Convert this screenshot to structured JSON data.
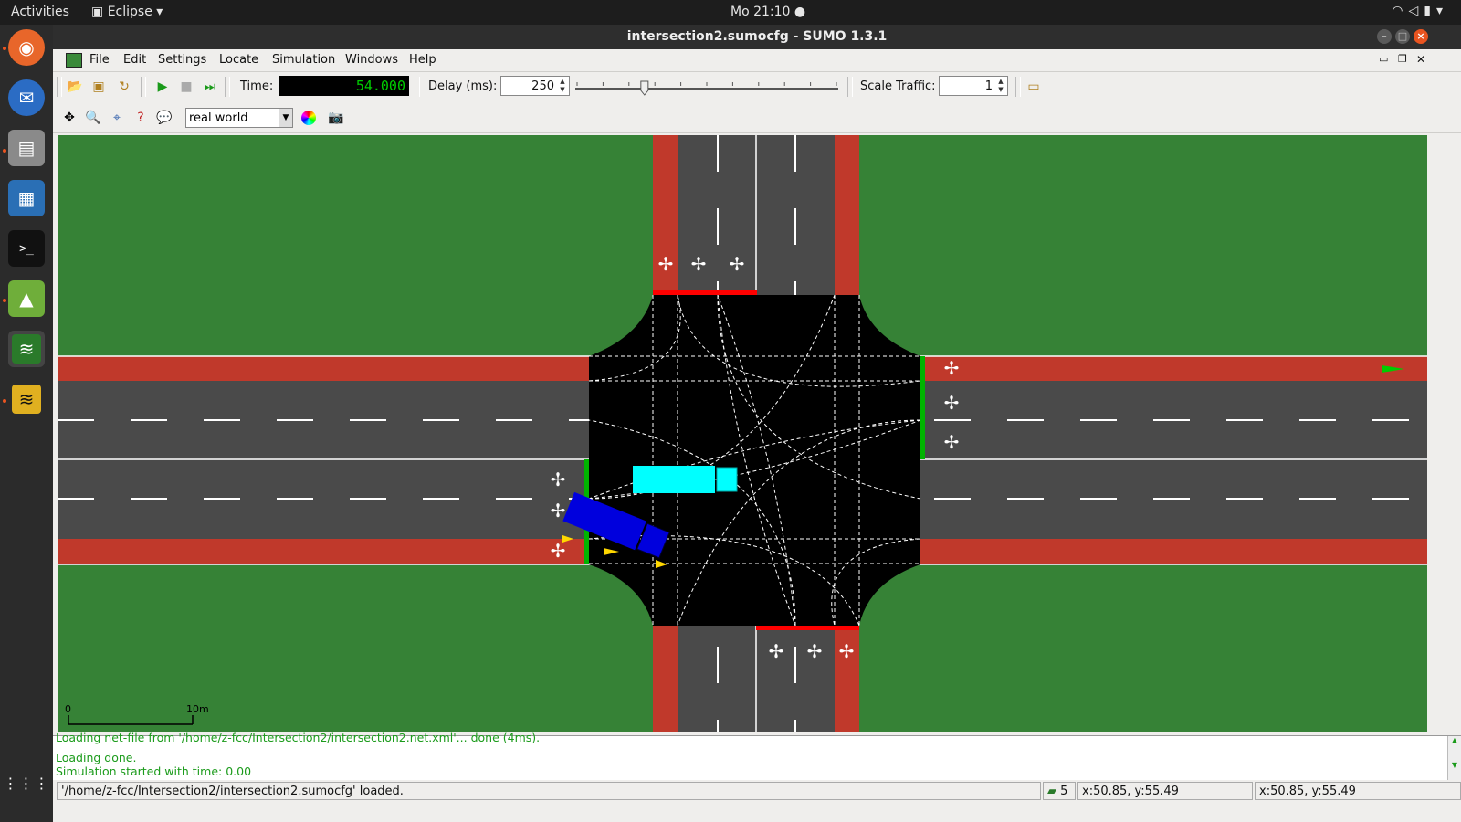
{
  "top_bar": {
    "activities": "Activities",
    "app_name": "Eclipse",
    "clock": "Mo 21:10"
  },
  "dock": {
    "items": [
      "firefox-icon",
      "thunderbird-icon",
      "files-icon",
      "libreoffice-icon",
      "terminal-icon",
      "image-viewer-icon",
      "sumo-icon",
      "netedit-icon",
      "app-grid-icon"
    ]
  },
  "window": {
    "title": "intersection2.sumocfg - SUMO 1.3.1"
  },
  "menu": {
    "file": "File",
    "edit": "Edit",
    "settings": "Settings",
    "locate": "Locate",
    "simulation": "Simulation",
    "windows": "Windows",
    "help": "Help"
  },
  "toolbar": {
    "time_label": "Time:",
    "time_value": "54.000",
    "delay_label": "Delay (ms):",
    "delay_value": "250",
    "delay_fraction": 0.26,
    "scale_label": "Scale Traffic:",
    "scale_value": "1"
  },
  "view": {
    "scheme": "real world",
    "scale_start": "0",
    "scale_end": "10m"
  },
  "messages": [
    "Loading net-file from '/home/z-fcc/Intersection2/intersection2.net.xml'... done (4ms).",
    "Loading done.",
    "Simulation started with time: 0.00"
  ],
  "status": {
    "message": "'/home/z-fcc/Intersection2/intersection2.sumocfg' loaded.",
    "vehicle_count": "5",
    "coord1": "x:50.85, y:55.49",
    "coord2": "x:50.85, y:55.49"
  },
  "colors": {
    "grass": "#368236",
    "road": "#4a4a4a",
    "bike_lane": "#c0392b",
    "junction": "#000000",
    "signal_red": "#ff0000",
    "signal_green": "#00b400",
    "truck_cyan": "#00ffff",
    "truck_blue": "#0000dd",
    "car_yellow": "#ffd700"
  }
}
